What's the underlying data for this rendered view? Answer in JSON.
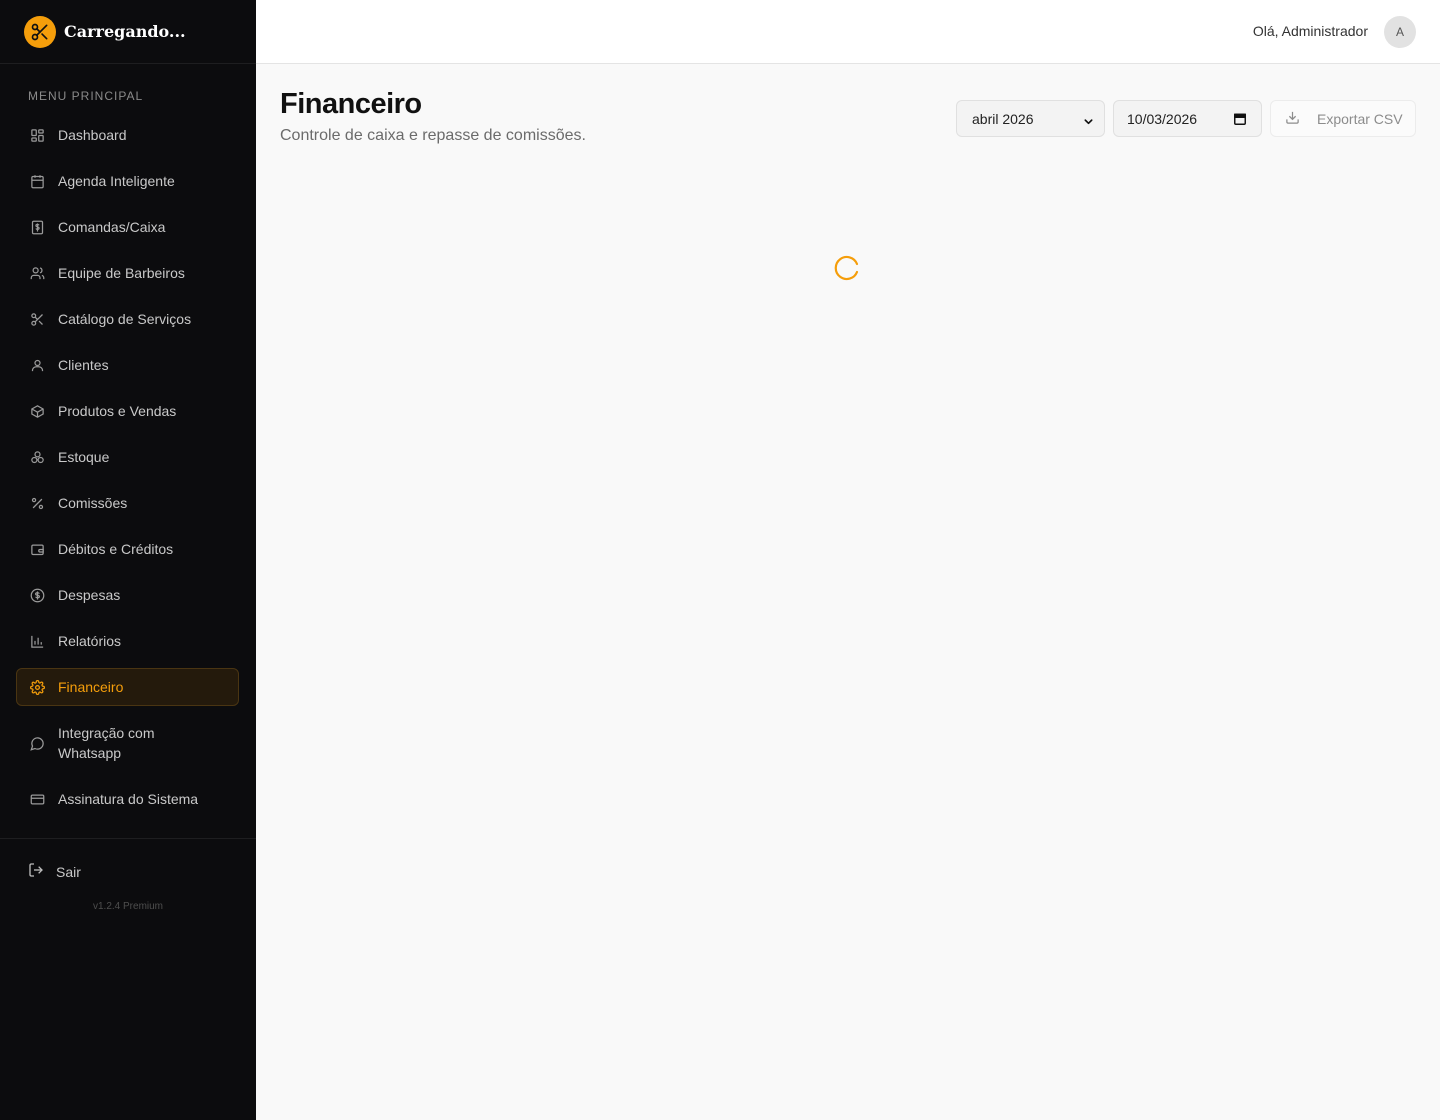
{
  "brand": {
    "name": "Carregando..."
  },
  "sidebar": {
    "heading": "MENU PRINCIPAL",
    "items": [
      {
        "label": "Dashboard",
        "icon": "dashboard-icon"
      },
      {
        "label": "Agenda Inteligente",
        "icon": "calendar-icon"
      },
      {
        "label": "Comandas/Caixa",
        "icon": "receipt-icon"
      },
      {
        "label": "Equipe de Barbeiros",
        "icon": "users-icon"
      },
      {
        "label": "Catálogo de Serviços",
        "icon": "scissors-icon"
      },
      {
        "label": "Clientes",
        "icon": "user-icon"
      },
      {
        "label": "Produtos e Vendas",
        "icon": "package-icon"
      },
      {
        "label": "Estoque",
        "icon": "boxes-icon"
      },
      {
        "label": "Comissões",
        "icon": "percent-icon"
      },
      {
        "label": "Débitos e Créditos",
        "icon": "wallet-icon"
      },
      {
        "label": "Despesas",
        "icon": "dollar-circle-icon"
      },
      {
        "label": "Relatórios",
        "icon": "bar-chart-icon"
      },
      {
        "label": "Financeiro",
        "icon": "gear-icon",
        "active": true
      },
      {
        "label": "Integração com Whatsapp",
        "icon": "chat-icon"
      },
      {
        "label": "Assinatura do Sistema",
        "icon": "credit-card-icon"
      }
    ],
    "logout_label": "Sair",
    "version": "v1.2.4 Premium"
  },
  "header": {
    "greeting": "Olá, Administrador",
    "avatar_initial": "A"
  },
  "page": {
    "title": "Financeiro",
    "subtitle": "Controle de caixa e repasse de comissões."
  },
  "filters": {
    "month_selected": "abril 2026",
    "date_value": "10/03/2026",
    "export_label": "Exportar CSV"
  },
  "colors": {
    "accent": "#f59e0b",
    "sidebar_bg": "#0c0c0e",
    "content_bg": "#f9f9f9"
  }
}
